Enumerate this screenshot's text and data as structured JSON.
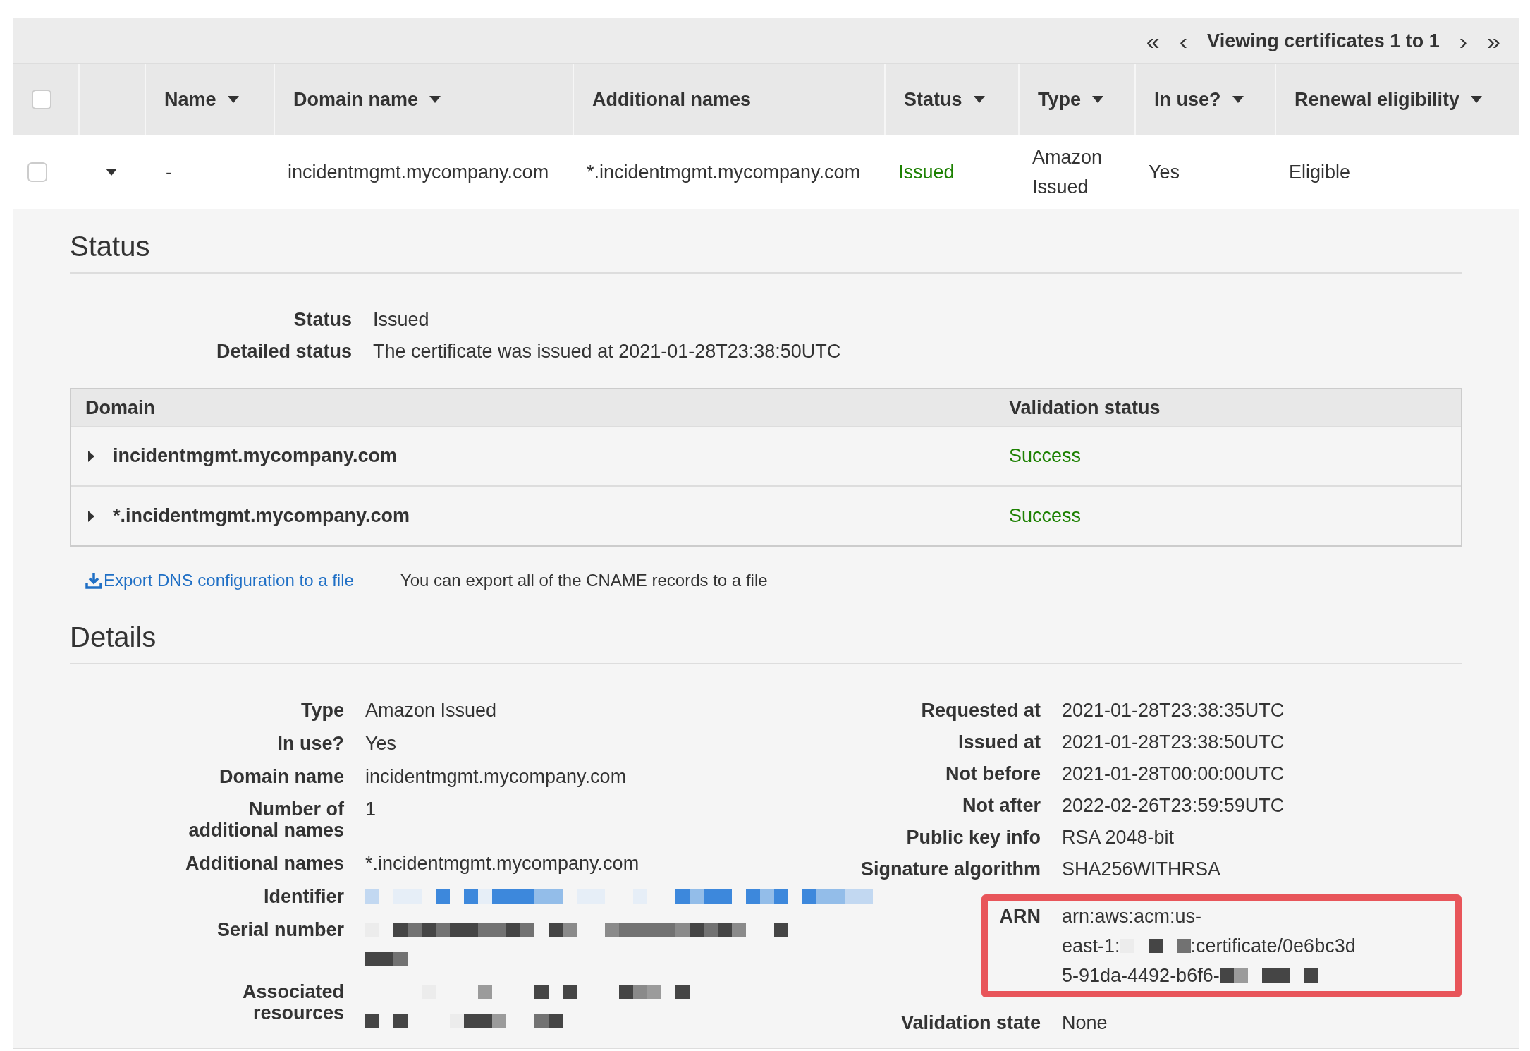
{
  "pager": {
    "first": "«",
    "prev": "‹",
    "label": "Viewing certificates 1 to 1",
    "next": "›",
    "last": "»"
  },
  "table": {
    "select_all_checked": false,
    "columns": [
      {
        "label": "Name",
        "sortable": true
      },
      {
        "label": "Domain name",
        "sortable": true
      },
      {
        "label": "Additional names",
        "sortable": false
      },
      {
        "label": "Status",
        "sortable": true
      },
      {
        "label": "Type",
        "sortable": true
      },
      {
        "label": "In use?",
        "sortable": true
      },
      {
        "label": "Renewal eligibility",
        "sortable": true
      }
    ],
    "rows": [
      {
        "checked": false,
        "expanded": true,
        "cells": [
          {
            "kind": "text",
            "text": "-"
          },
          {
            "kind": "text",
            "text": "incidentmgmt.mycompany.com"
          },
          {
            "kind": "text",
            "text": "*.incidentmgmt.mycompany.com"
          },
          {
            "kind": "status",
            "text": "Issued"
          },
          {
            "kind": "text",
            "text": "Amazon Issued"
          },
          {
            "kind": "text",
            "text": "Yes"
          },
          {
            "kind": "text",
            "text": "Eligible"
          }
        ]
      }
    ]
  },
  "status_section": {
    "title": "Status",
    "fields": [
      {
        "label": "Status",
        "value": "Issued"
      },
      {
        "label": "Detailed status",
        "value": "The certificate was issued at 2021-01-28T23:38:50UTC"
      }
    ],
    "domains": {
      "columns": [
        "Domain",
        "Validation status"
      ],
      "rows": [
        {
          "domain": "incidentmgmt.mycompany.com",
          "validation": "Success",
          "expanded": false
        },
        {
          "domain": "*.incidentmgmt.mycompany.com",
          "validation": "Success",
          "expanded": false
        }
      ]
    },
    "export_link": "Export DNS configuration to a file",
    "export_note": "You can export all of the CNAME records to a file"
  },
  "details": {
    "title": "Details",
    "left": [
      {
        "label": "Type",
        "value": "Amazon Issued"
      },
      {
        "label": "In use?",
        "value": "Yes"
      },
      {
        "label": "Domain name",
        "value": "incidentmgmt.mycompany.com"
      },
      {
        "label": "Number of additional names",
        "value": "1"
      },
      {
        "label": "Additional names",
        "value": "*.incidentmgmt.mycompany.com"
      },
      {
        "label": "Identifier",
        "lines": [
          [
            {
              "kind": "linkmask"
            }
          ]
        ]
      },
      {
        "label": "Serial number",
        "lines": [
          [
            {
              "kind": "mask"
            }
          ],
          [
            {
              "kind": "mask"
            }
          ]
        ]
      },
      {
        "label": "Associated resources",
        "lines": [
          [
            {
              "kind": "mask"
            }
          ],
          [
            {
              "kind": "mask"
            }
          ]
        ]
      }
    ],
    "right": [
      {
        "label": "Requested at",
        "value": "2021-01-28T23:38:35UTC"
      },
      {
        "label": "Issued at",
        "value": "2021-01-28T23:38:50UTC"
      },
      {
        "label": "Not before",
        "value": "2021-01-28T00:00:00UTC"
      },
      {
        "label": "Not after",
        "value": "2022-02-26T23:59:59UTC"
      },
      {
        "label": "Public key info",
        "value": "RSA 2048-bit"
      },
      {
        "label": "Signature algorithm",
        "value": "SHA256WITHRSA"
      },
      {
        "label": "ARN",
        "highlighted": true,
        "lines": [
          [
            {
              "kind": "text",
              "text": "arn:aws:acm:us-"
            }
          ],
          [
            {
              "kind": "text",
              "text": "east-1:"
            },
            {
              "kind": "mask"
            },
            {
              "kind": "text",
              "text": ":certificate/0e6bc3d"
            }
          ],
          [
            {
              "kind": "text",
              "text": "5-91da-4492-b6f6-"
            },
            {
              "kind": "mask"
            }
          ]
        ]
      },
      {
        "label": "Validation state",
        "value": "None"
      }
    ]
  }
}
